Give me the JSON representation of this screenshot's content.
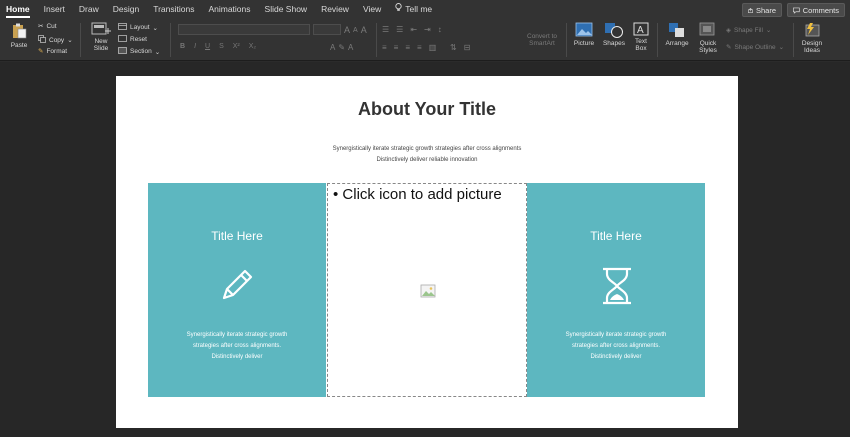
{
  "tabs": [
    "Home",
    "Insert",
    "Draw",
    "Design",
    "Transitions",
    "Animations",
    "Slide Show",
    "Review",
    "View"
  ],
  "tell_me": "Tell me",
  "share_label": "Share",
  "comments_label": "Comments",
  "ribbon": {
    "paste": "Paste",
    "cut": "Cut",
    "copy": "Copy",
    "format": "Format",
    "new_slide_1": "New",
    "new_slide_2": "Slide",
    "layout": "Layout",
    "reset": "Reset",
    "section": "Section",
    "convert_1": "Convert to",
    "convert_2": "SmartArt",
    "picture": "Picture",
    "shapes": "Shapes",
    "textbox_1": "Text",
    "textbox_2": "Box",
    "arrange": "Arrange",
    "quick_styles_1": "Quick",
    "quick_styles_2": "Styles",
    "shape_fill": "Shape Fill",
    "shape_outline": "Shape Outline",
    "design_ideas_1": "Design",
    "design_ideas_2": "Ideas"
  },
  "slide": {
    "title": "About Your Title",
    "subtitle_line1": "Synergistically iterate strategic growth strategies after cross alignments",
    "subtitle_line2": "Distinctively deliver reliable innovation",
    "placeholder_text": "• Click icon to add picture",
    "left_panel": {
      "title": "Title Here",
      "line1": "Synergistically iterate strategic growth",
      "line2": "strategies after cross alignments.",
      "line3": "Distinctively deliver"
    },
    "right_panel": {
      "title": "Title Here",
      "line1": "Synergistically iterate strategic growth",
      "line2": "strategies after cross alignments.",
      "line3": "Distinctively deliver"
    }
  },
  "colors": {
    "accent_teal": "#5db7c0",
    "ribbon_bg": "#333333",
    "canvas_bg": "#272727"
  }
}
